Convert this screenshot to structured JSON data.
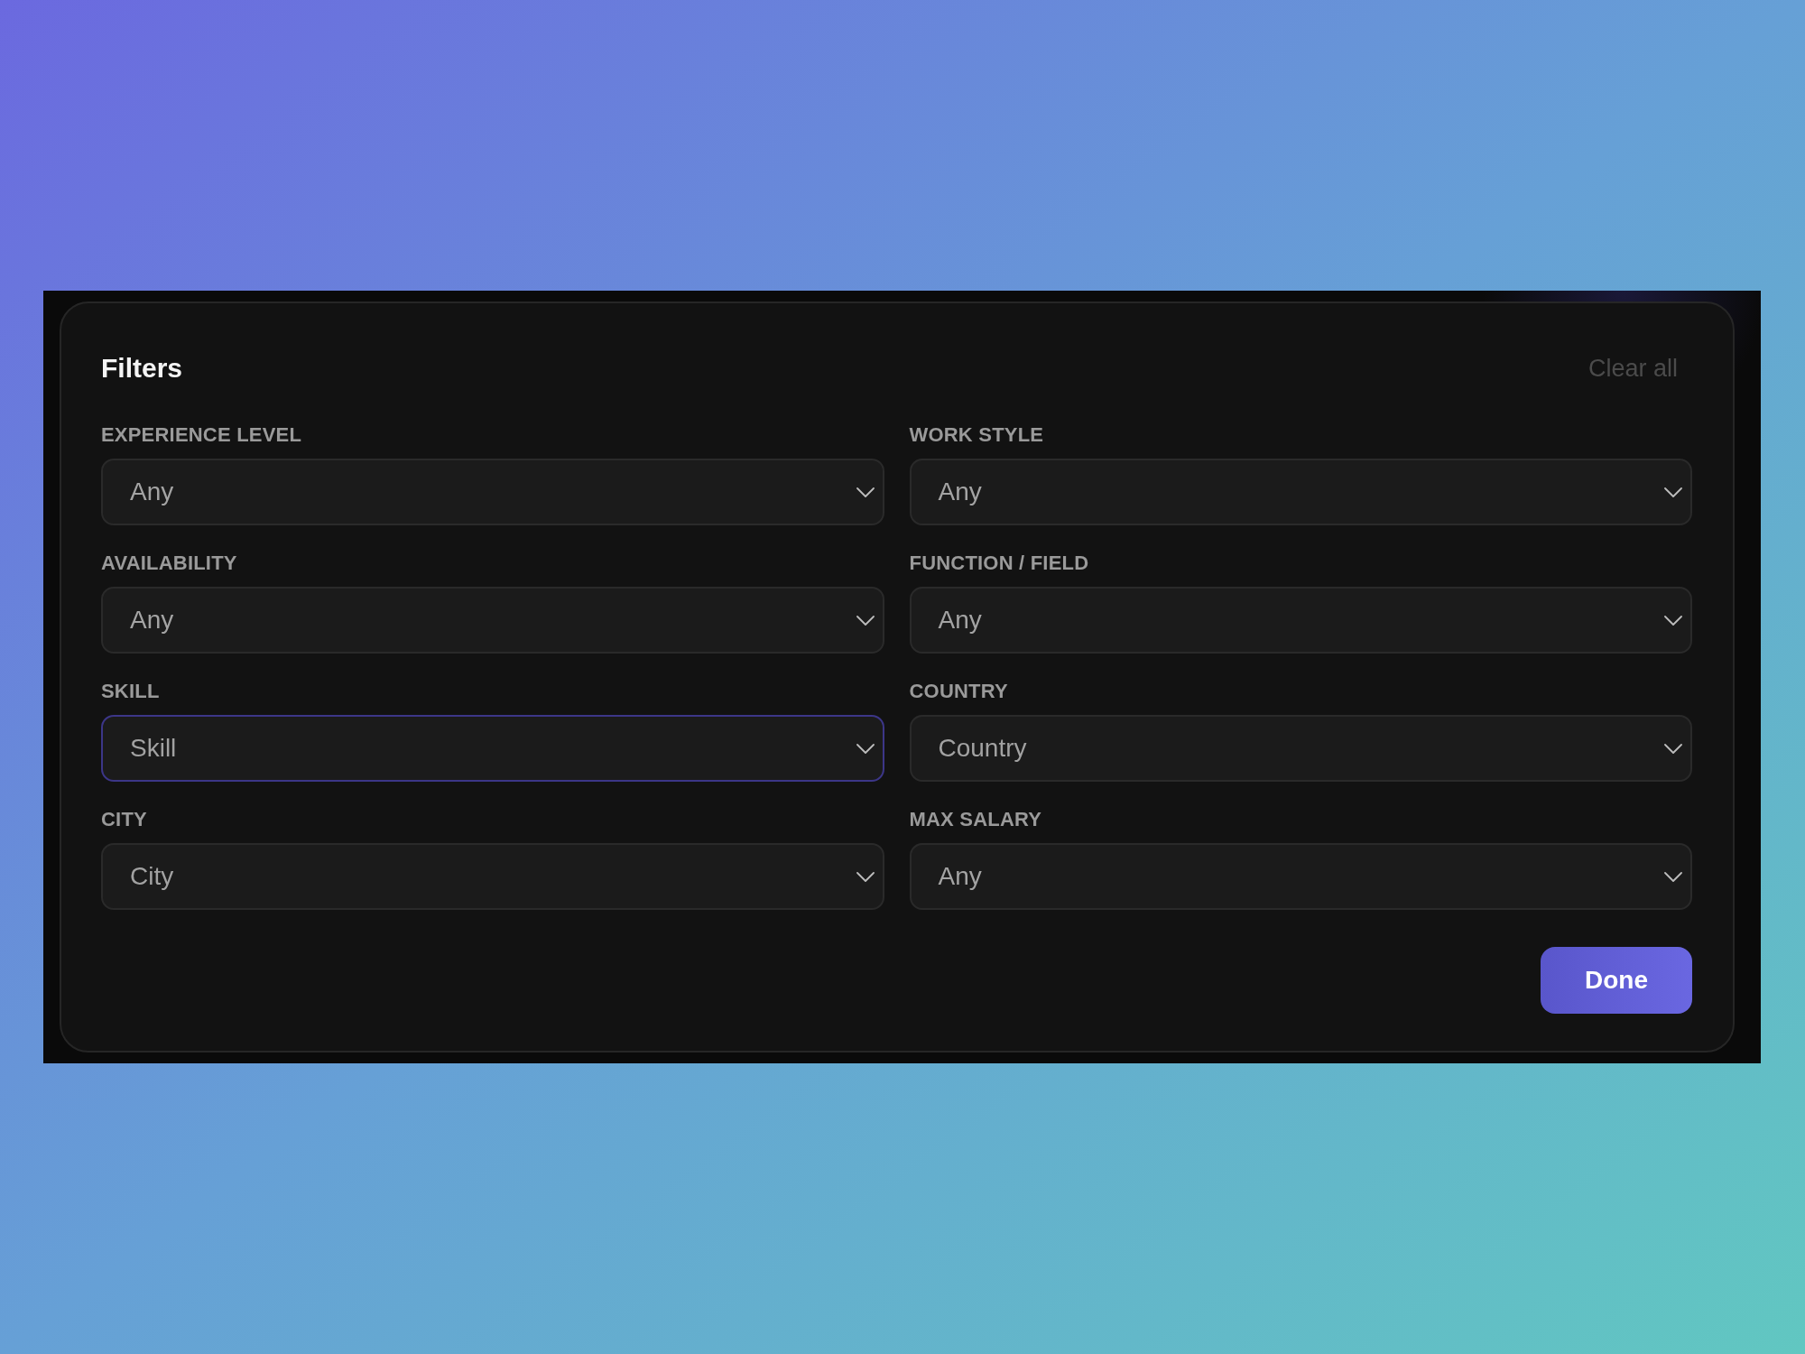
{
  "panel": {
    "title": "Filters",
    "clear_button": "Clear all",
    "fields": [
      {
        "label": "EXPERIENCE LEVEL",
        "value": "Any",
        "focused": false
      },
      {
        "label": "WORK STYLE",
        "value": "Any",
        "focused": false
      },
      {
        "label": "AVAILABILITY",
        "value": "Any",
        "focused": false
      },
      {
        "label": "FUNCTION / FIELD",
        "value": "Any",
        "focused": false
      },
      {
        "label": "SKILL",
        "placeholder": "Skill",
        "focused": true
      },
      {
        "label": "COUNTRY",
        "placeholder": "Country",
        "focused": false
      },
      {
        "label": "CITY",
        "placeholder": "City",
        "focused": false
      },
      {
        "label": "MAX SALARY",
        "value": "Any",
        "focused": false
      }
    ],
    "done_button": "Done"
  }
}
